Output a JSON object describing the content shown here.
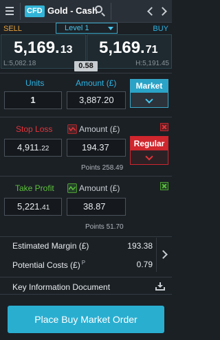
{
  "header": {
    "menu_icon": "hamburger-menu-icon",
    "badge": "CFD",
    "instrument": "Gold - Cash",
    "search_icon": "search-icon",
    "prev_icon": "chevron-left-icon",
    "next_icon": "chevron-right-icon"
  },
  "quote": {
    "sell_label": "SELL",
    "buy_label": "BUY",
    "level": "Level 1",
    "sell_main": "5,169.",
    "sell_frac": "13",
    "buy_main": "5,169.",
    "buy_frac": "71",
    "low": "L:5,082.18",
    "high": "H:5,191.45",
    "spread": "0.58"
  },
  "size": {
    "units_label": "Units",
    "amount_label": "Amount (£)",
    "units_value": "1",
    "amount_value": "3,887.20",
    "order_type": "Market"
  },
  "stop_loss": {
    "label": "Stop Loss",
    "amount_label": "Amount (£)",
    "price_main": "4,911.",
    "price_frac": "22",
    "amount_value": "194.37",
    "points": "Points 258.49",
    "type": "Regular"
  },
  "take_profit": {
    "label": "Take Profit",
    "amount_label": "Amount (£)",
    "price_main": "5,221.",
    "price_frac": "41",
    "amount_value": "38.87",
    "points": "Points 51.70"
  },
  "summary": {
    "margin_label": "Estimated Margin (£)",
    "margin_value": "193.38",
    "costs_label": "Potential Costs (£)",
    "costs_marker": "P",
    "costs_value": "0.79",
    "kid_label": "Key Information Document"
  },
  "action": {
    "place_order": "Place Buy Market Order"
  },
  "colors": {
    "accent": "#2aaed0",
    "sell": "#e8a13a",
    "stop_loss": "#e5343a",
    "take_profit": "#5cc13b",
    "background": "#1b2025"
  }
}
